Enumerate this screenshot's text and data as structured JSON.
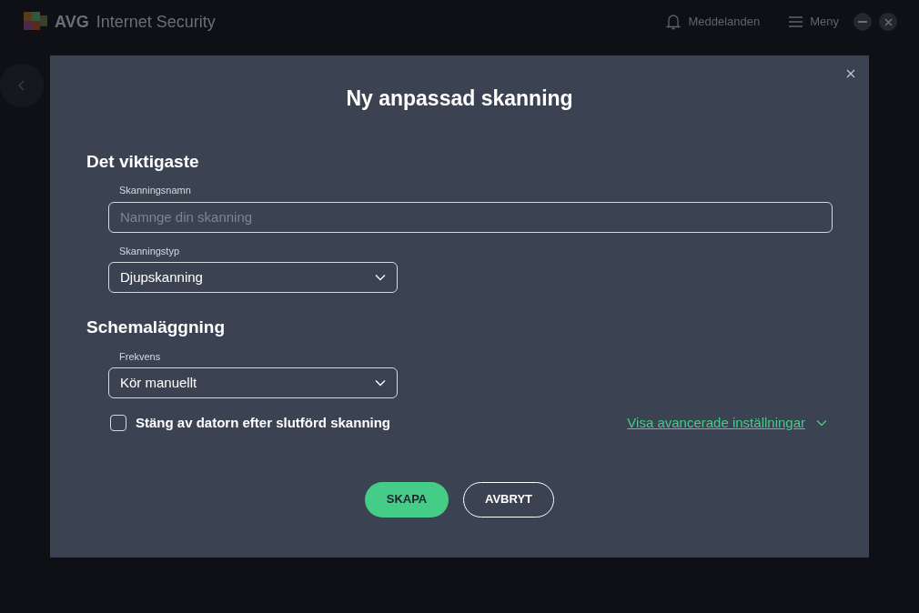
{
  "app": {
    "brand": "AVG",
    "title": "Internet Security",
    "notifications": "Meddelanden",
    "menu": "Meny"
  },
  "dialog": {
    "title": "Ny anpassad skanning",
    "sections": [
      {
        "heading": "Det viktigaste",
        "fields": [
          {
            "kind": "text",
            "label": "Skanningsnamn",
            "placeholder": "Namnge din skanning"
          },
          {
            "kind": "select",
            "label": "Skanningstyp",
            "value": "Djupskanning"
          }
        ]
      },
      {
        "heading": "Schemaläggning",
        "fields": [
          {
            "kind": "select",
            "label": "Frekvens",
            "value": "Kör manuellt"
          }
        ]
      }
    ],
    "checkbox": {
      "label": "Stäng av datorn efter slutförd skanning",
      "checked": false
    },
    "advanced_link": "Visa avancerade inställningar",
    "buttons": [
      {
        "label": "SKAPA",
        "kind": "primary"
      },
      {
        "label": "AVBRYT",
        "kind": "secondary"
      }
    ]
  }
}
